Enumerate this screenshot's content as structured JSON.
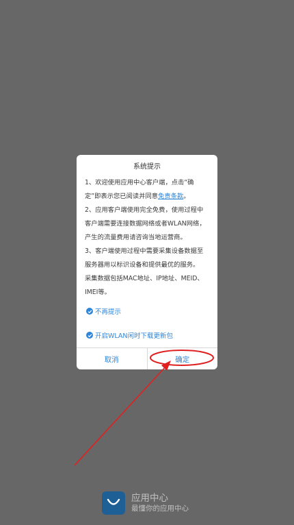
{
  "dialog": {
    "title": "系统提示",
    "lines": [
      {
        "text": "1、欢迎使用应用中心客户端，点击“确"
      },
      {
        "pre": "定”即表示您已阅读并同意",
        "link": "免责条款",
        "post": "。"
      },
      {
        "text": "2、应用客户端使用完全免费，使用过程中"
      },
      {
        "text": "客户端需要连接数据网络或者WLAN网络，"
      },
      {
        "text": "产生的流量费用请咨询当地运营商。"
      },
      {
        "text": "3、客户端使用过程中需要采集设备数据至"
      },
      {
        "text": "服务器用以标识设备和提供最优的服务。"
      },
      {
        "text": "采集数据包括MAC地址、IP地址、MEID、"
      },
      {
        "text": "IMEI等。"
      }
    ],
    "options": {
      "no_remind": {
        "label": "不再提示",
        "checked": true
      },
      "wlan_update": {
        "label": "开启WLAN闲时下载更新包",
        "checked": true
      }
    },
    "buttons": {
      "cancel": "取消",
      "confirm": "确定"
    }
  },
  "annotation": {
    "color": "#e02020"
  },
  "brand": {
    "name": "应用中心",
    "slogan": "最懂你的应用中心"
  },
  "colors": {
    "accent": "#2f86d8",
    "backdrop": "#676767",
    "brand_logo": "#1e5f95"
  }
}
